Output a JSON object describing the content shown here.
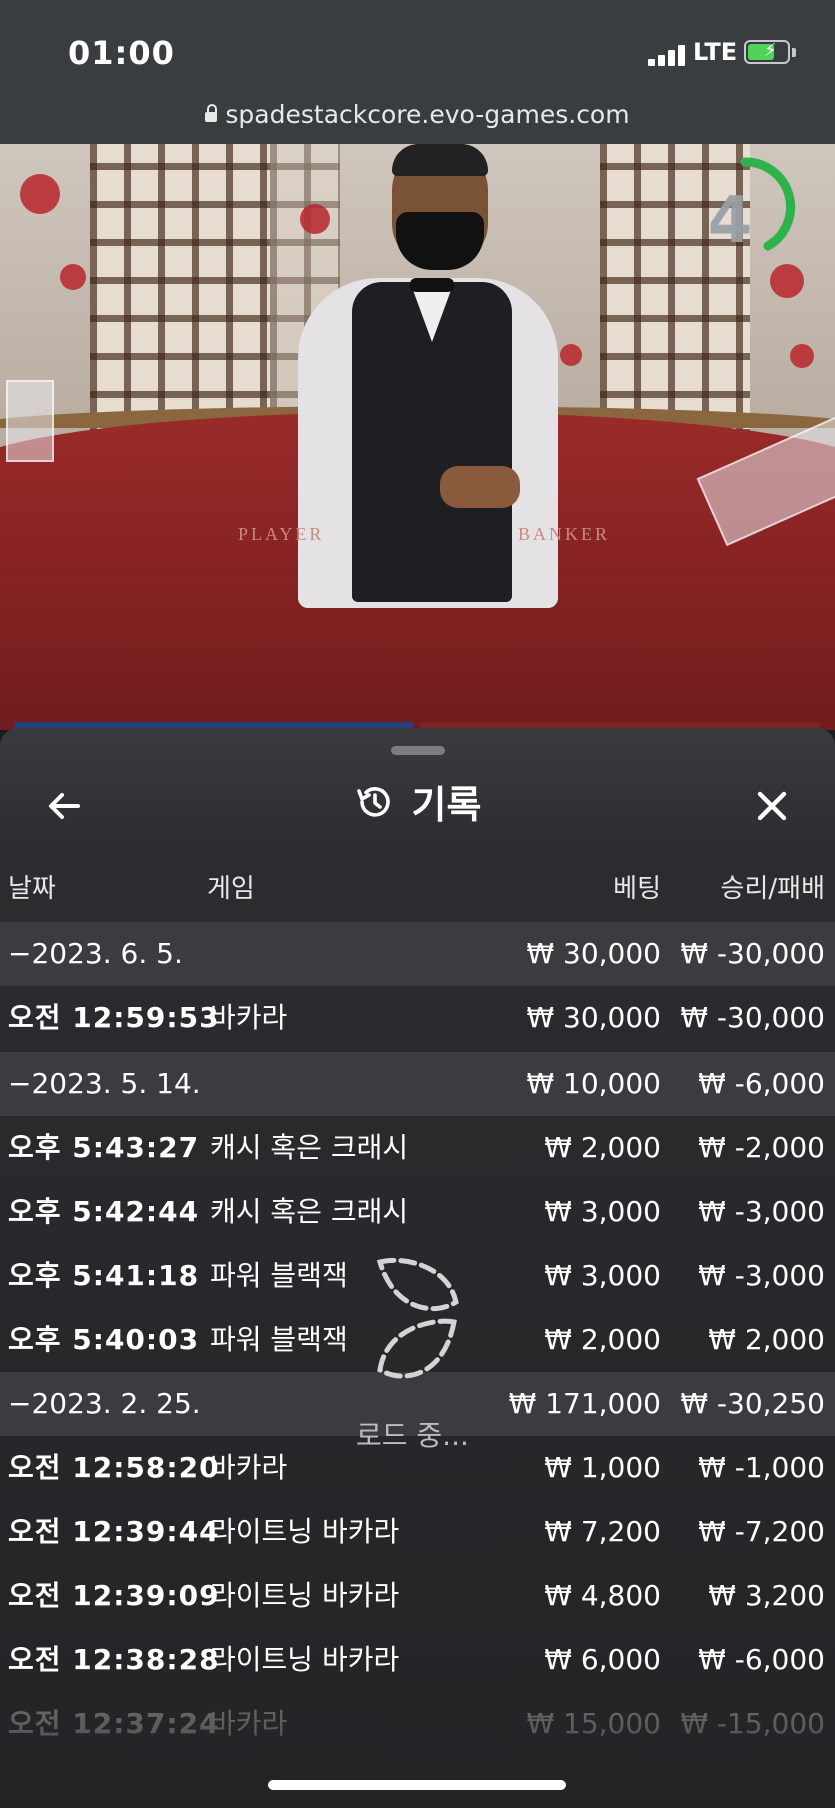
{
  "status_bar": {
    "time": "01:00",
    "network": "LTE"
  },
  "browser": {
    "url": "spadestackcore.evo-games.com"
  },
  "video": {
    "table_label_left": "PLAYER",
    "table_label_right": "BANKER",
    "countdown": "4",
    "countdown_color": "#2db34a"
  },
  "panel": {
    "title": "기록",
    "columns": {
      "date": "날짜",
      "game": "게임",
      "bet": "베팅",
      "result": "승리/패배"
    },
    "groups": [
      {
        "date": "−2023. 6. 5.",
        "bet": "₩ 30,000",
        "result": "₩ -30,000",
        "rows": [
          {
            "time": "오전 12:59:53",
            "game": "바카라",
            "bet": "₩ 30,000",
            "result": "₩ -30,000"
          }
        ]
      },
      {
        "date": "−2023. 5. 14.",
        "bet": "₩ 10,000",
        "result": "₩ -6,000",
        "rows": [
          {
            "time": "오후 5:43:27",
            "game": "캐시 혹은 크래시",
            "bet": "₩ 2,000",
            "result": "₩ -2,000"
          },
          {
            "time": "오후 5:42:44",
            "game": "캐시 혹은 크래시",
            "bet": "₩ 3,000",
            "result": "₩ -3,000"
          },
          {
            "time": "오후 5:41:18",
            "game": "파워 블랙잭",
            "bet": "₩ 3,000",
            "result": "₩ -3,000"
          },
          {
            "time": "오후 5:40:03",
            "game": "파워 블랙잭",
            "bet": "₩ 2,000",
            "result": "₩ 2,000"
          }
        ]
      },
      {
        "date": "−2023. 2. 25.",
        "bet": "₩ 171,000",
        "result": "₩ -30,250",
        "rows": [
          {
            "time": "오전 12:58:20",
            "game": "바카라",
            "bet": "₩ 1,000",
            "result": "₩ -1,000"
          },
          {
            "time": "오전 12:39:44",
            "game": "라이트닝 바카라",
            "bet": "₩ 7,200",
            "result": "₩ -7,200"
          },
          {
            "time": "오전 12:39:09",
            "game": "라이트닝 바카라",
            "bet": "₩ 4,800",
            "result": "₩ 3,200"
          },
          {
            "time": "오전 12:38:28",
            "game": "라이트닝 바카라",
            "bet": "₩ 6,000",
            "result": "₩ -6,000"
          },
          {
            "time": "오전 12:37:24",
            "game": "바카라",
            "bet": "₩ 15,000",
            "result": "₩ -15,000"
          }
        ]
      }
    ],
    "loading_text": "로드 중..."
  }
}
